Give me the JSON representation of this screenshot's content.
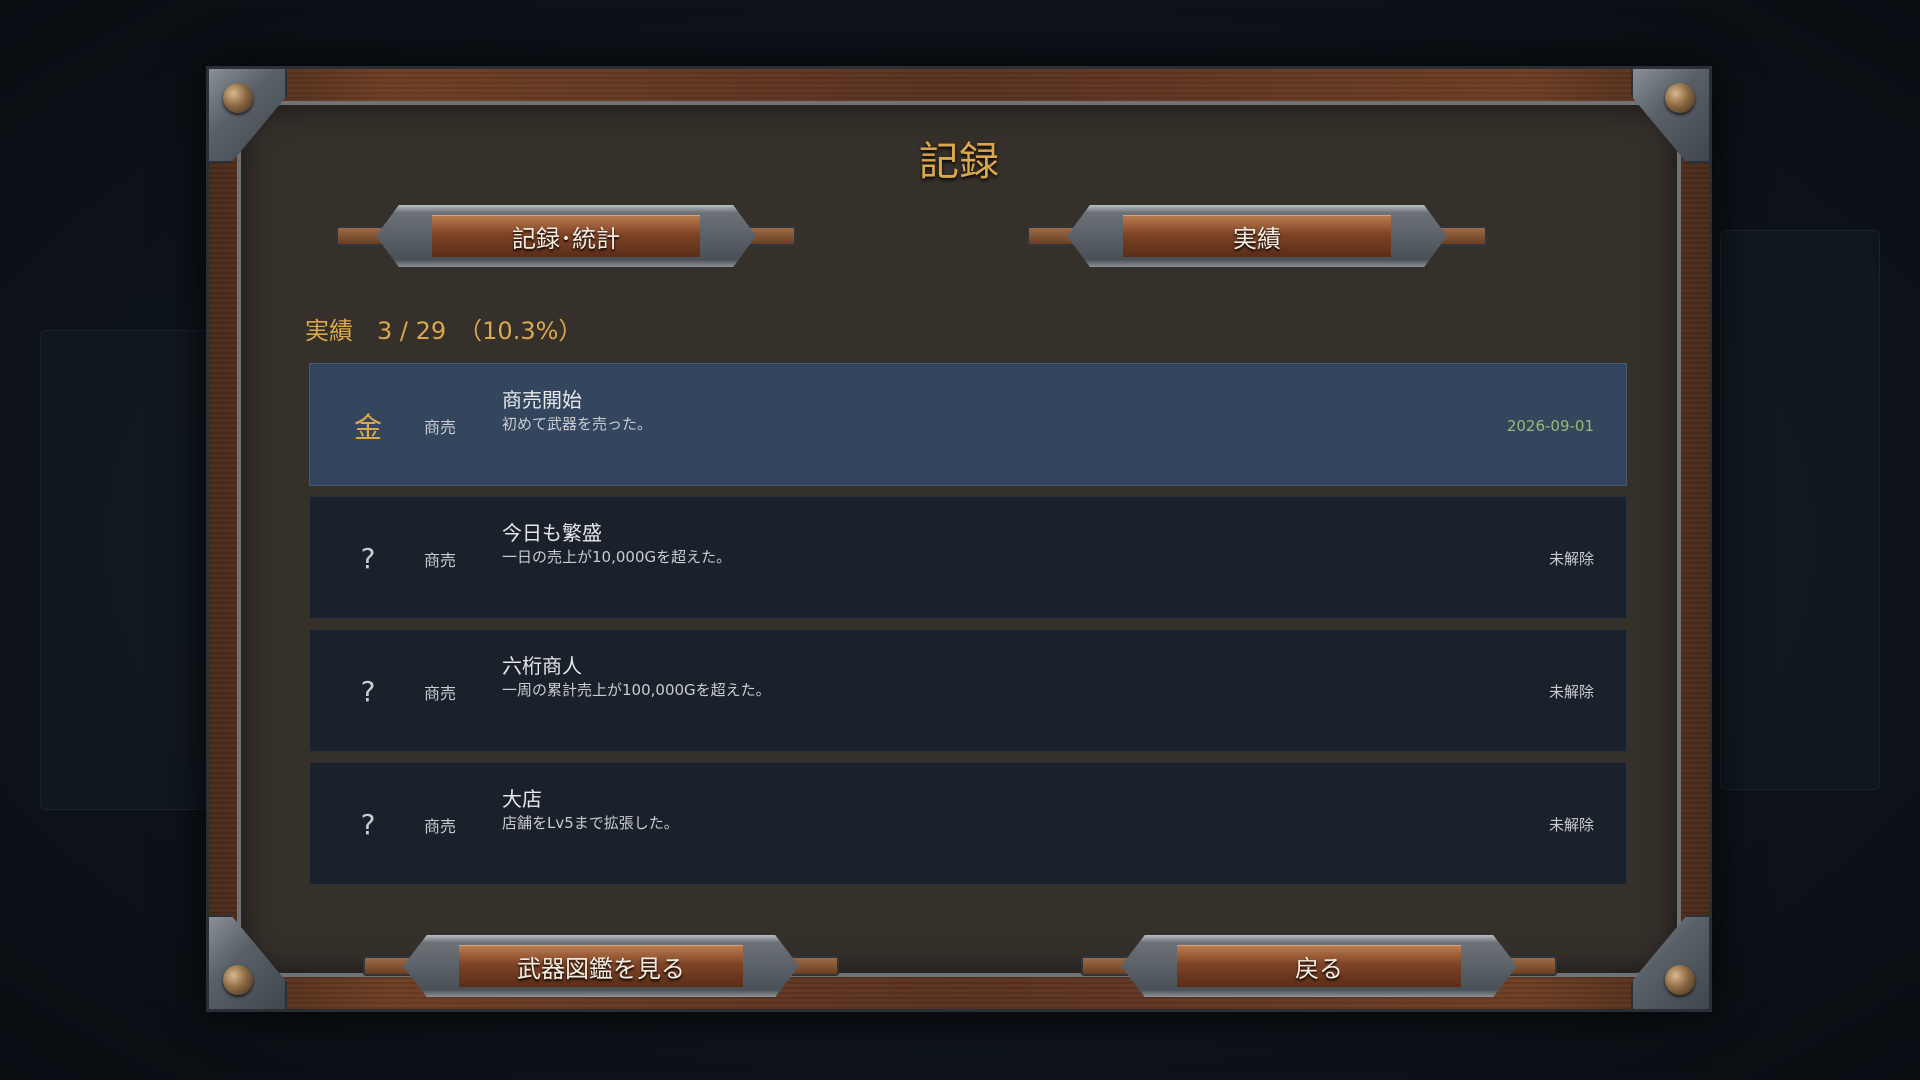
{
  "dialog": {
    "title": "記録"
  },
  "tabs": [
    {
      "label": "記録･統計"
    },
    {
      "label": "実績"
    }
  ],
  "counter": {
    "text": "実績　3 / 29　（10.3%）"
  },
  "achievements": [
    {
      "icon": "金",
      "category": "商売",
      "name": "商売開始",
      "description": "初めて武器を売った。",
      "status": "2026-09-01",
      "unlocked": true
    },
    {
      "icon": "?",
      "category": "商売",
      "name": "今日も繁盛",
      "description": "一日の売上が10,000Gを超えた。",
      "status": "未解除",
      "unlocked": false
    },
    {
      "icon": "?",
      "category": "商売",
      "name": "六桁商人",
      "description": "一周の累計売上が100,000Gを超えた。",
      "status": "未解除",
      "unlocked": false
    },
    {
      "icon": "?",
      "category": "商売",
      "name": "大店",
      "description": "店舗をLv5まで拡張した。",
      "status": "未解除",
      "unlocked": false
    }
  ],
  "footer": {
    "weapon_book_label": "武器図鑑を見る",
    "back_label": "戻る"
  },
  "colors": {
    "accent_gold": "#d9a84e",
    "unlocked_row": "#34465e",
    "locked_row": "#1a212b",
    "date_green": "#9ab870"
  }
}
